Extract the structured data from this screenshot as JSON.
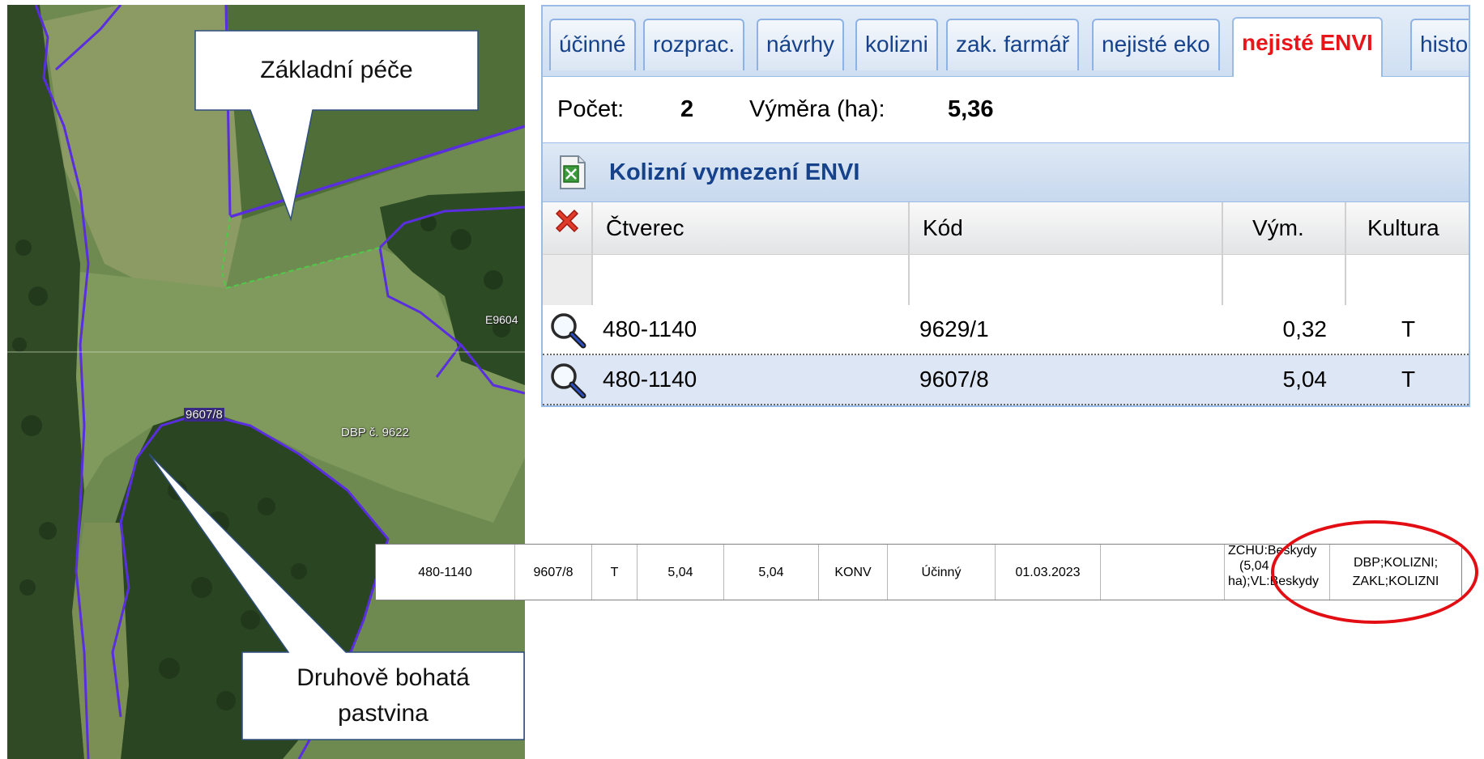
{
  "map": {
    "parcel_labels": [
      "9607/8",
      "DBP č. 9622",
      "E9604"
    ],
    "callout_top": "Základní péče",
    "callout_bottom_line1": "Druhově bohatá",
    "callout_bottom_line2": "pastvina"
  },
  "tabs": [
    {
      "label": "účinné"
    },
    {
      "label": "rozprac."
    },
    {
      "label": "návrhy"
    },
    {
      "label": "kolizni"
    },
    {
      "label": "zak. farmář"
    },
    {
      "label": "nejisté eko"
    },
    {
      "label": "nejisté ENVI",
      "active": true
    },
    {
      "label": "histo"
    }
  ],
  "summary": {
    "count_label": "Počet:",
    "count_value": "2",
    "area_label": "Výměra (ha):",
    "area_value": "5,36"
  },
  "grid": {
    "title": "Kolizní vymezení ENVI",
    "columns": [
      "Čtverec",
      "Kód",
      "Vým.",
      "Kultura"
    ],
    "rows": [
      {
        "ctverec": "480-1140",
        "kod": "9629/1",
        "vym": "0,32",
        "kultura": "T"
      },
      {
        "ctverec": "480-1140",
        "kod": "9607/8",
        "vym": "5,04",
        "kultura": "T"
      }
    ]
  },
  "detail_row": {
    "cells": [
      "480-1140",
      "9607/8",
      "T",
      "5,04",
      "5,04",
      "KONV",
      "Účinný",
      "01.03.2023",
      ""
    ],
    "zchu_line1": "ZCHU:Beskydy",
    "zchu_line2": "(5,04",
    "zchu_line3": "ha);VL:Beskydy",
    "flags_line1": "DBP;KOLIZNI;",
    "flags_line2": "ZAKL;KOLIZNI"
  },
  "colors": {
    "active_tab_text": "#e8151b",
    "highlight_ring": "#e30e14",
    "parcel_boundary": "#5a2ee0",
    "grid_header_blue": "#15428b"
  }
}
